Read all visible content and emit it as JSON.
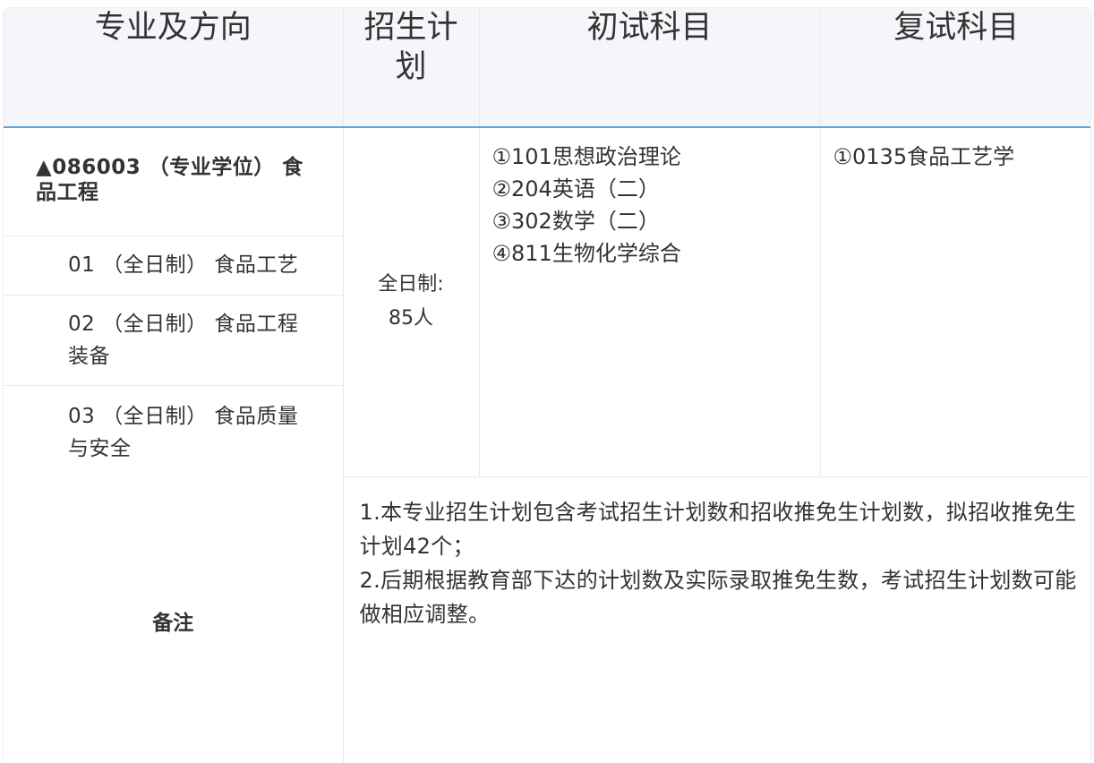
{
  "table": {
    "headers": [
      "专业及方向",
      "招生计划",
      "初试科目",
      "复试科目"
    ],
    "major": "▲086003 （专业学位） 食品工程",
    "directions": [
      "01 （全日制） 食品工艺",
      "02 （全日制） 食品工程装备",
      "03 （全日制） 食品质量与安全"
    ],
    "plan": {
      "line1": "全日制:",
      "line2": "85人"
    },
    "initial_subjects": [
      "①101思想政治理论",
      "②204英语（二）",
      "③302数学（二）",
      "④811生物化学综合"
    ],
    "retest_subjects": [
      "①0135食品工艺学"
    ],
    "remark": {
      "label": "备注",
      "lines": [
        "1.本专业招生计划包含考试招生计划数和招收推免生计划数，拟招收推免生计划42个；",
        "2.后期根据教育部下达的计划数及实际录取推免生数，考试招生计划数可能做相应调整。"
      ]
    }
  },
  "colors": {
    "header_bg": "#f4f6fa",
    "header_underline": "#5aa7e0",
    "border": "#e8eaee",
    "text": "#333333"
  }
}
